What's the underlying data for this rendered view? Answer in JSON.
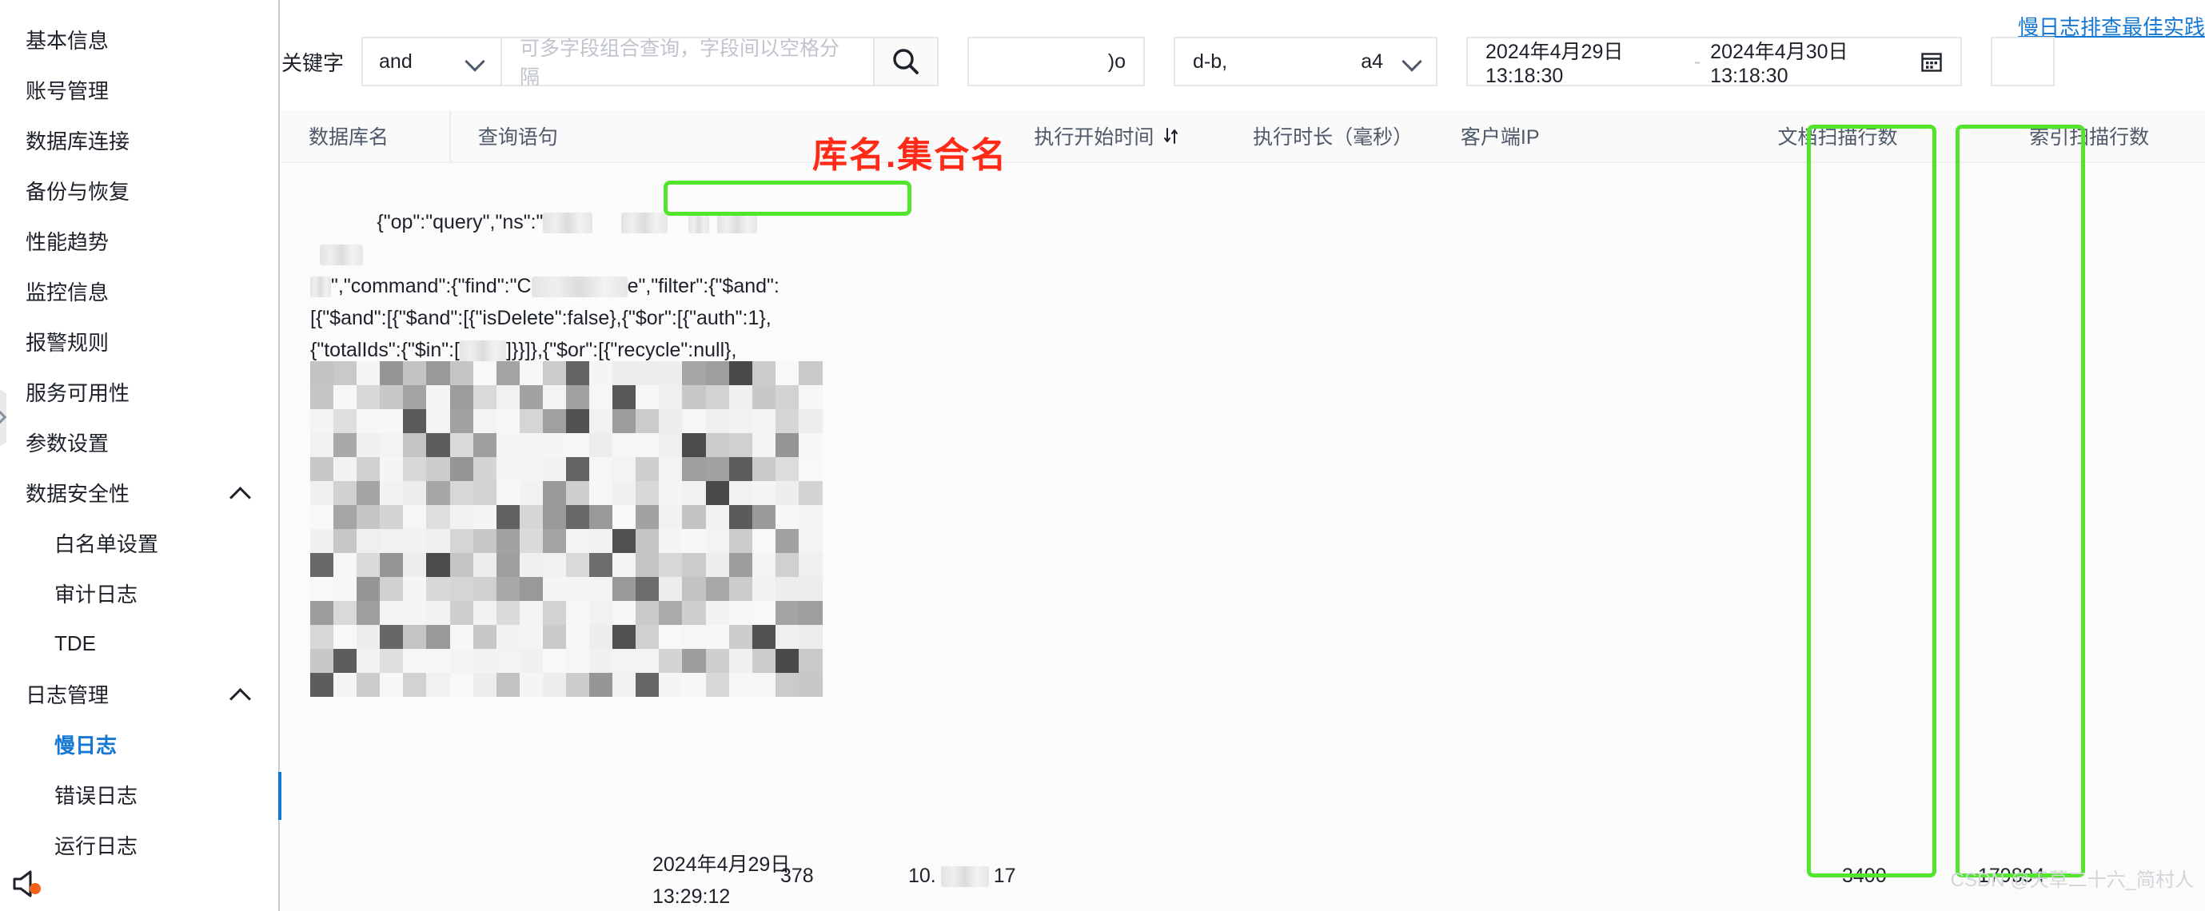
{
  "sidebar": {
    "items": [
      {
        "label": "基本信息",
        "level": 0,
        "expandable": false,
        "active": false
      },
      {
        "label": "账号管理",
        "level": 0,
        "expandable": false,
        "active": false
      },
      {
        "label": "数据库连接",
        "level": 0,
        "expandable": false,
        "active": false
      },
      {
        "label": "备份与恢复",
        "level": 0,
        "expandable": false,
        "active": false
      },
      {
        "label": "性能趋势",
        "level": 0,
        "expandable": false,
        "active": false
      },
      {
        "label": "监控信息",
        "level": 0,
        "expandable": false,
        "active": false
      },
      {
        "label": "报警规则",
        "level": 0,
        "expandable": false,
        "active": false
      },
      {
        "label": "服务可用性",
        "level": 0,
        "expandable": false,
        "active": false
      },
      {
        "label": "参数设置",
        "level": 0,
        "expandable": false,
        "active": false
      },
      {
        "label": "数据安全性",
        "level": 0,
        "expandable": true,
        "active": false
      },
      {
        "label": "白名单设置",
        "level": 1,
        "expandable": false,
        "active": false
      },
      {
        "label": "审计日志",
        "level": 1,
        "expandable": false,
        "active": false
      },
      {
        "label": "TDE",
        "level": 1,
        "expandable": false,
        "active": false
      },
      {
        "label": "日志管理",
        "level": 0,
        "expandable": true,
        "active": false
      },
      {
        "label": "慢日志",
        "level": 1,
        "expandable": false,
        "active": true
      },
      {
        "label": "错误日志",
        "level": 1,
        "expandable": false,
        "active": false
      },
      {
        "label": "运行日志",
        "level": 1,
        "expandable": false,
        "active": false
      }
    ],
    "collapse_handle": "collapse-sidebar",
    "announcement_icon": "speaker-icon"
  },
  "header": {
    "best_practice_link": "慢日志排查最佳实践"
  },
  "toolbar": {
    "keyword_label": "关键字",
    "logic_operator": "and",
    "keyword_placeholder": "可多字段组合查询，字段间以空格分隔",
    "keyword_value": "",
    "search_icon": "search-icon",
    "node_filter_value": ")o",
    "instance_value_left": "d-b,",
    "instance_value_mid": "⸮",
    "instance_value_right": "a4",
    "date_start": "2024年4月29日 13:18:30",
    "date_separator": "-",
    "date_end": "2024年4月30日 13:18:30",
    "calendar_icon": "calendar-icon"
  },
  "table": {
    "columns": [
      {
        "key": "db",
        "label": "数据库名"
      },
      {
        "key": "q",
        "label": "查询语句"
      },
      {
        "key": "st",
        "label": "执行开始时间",
        "sortable": true
      },
      {
        "key": "dur",
        "label": "执行时长（毫秒）"
      },
      {
        "key": "ip",
        "label": "客户端IP"
      },
      {
        "key": "docs",
        "label": "文档扫描行数"
      },
      {
        "key": "idx",
        "label": "索引扫描行数"
      }
    ],
    "rows": [
      {
        "db": "",
        "query": "{\"op\":\"query\",\"ns\":\"▒▒▒▒ .▒▒ ▒▒▒▒ ▒▒▒▒ .▒▒▒▒▒▒\",\"command\":{\"find\":\"C▒▒▒▒▒▒e\",\"filter\":{\"$and\":[{\"$and\":[{\"$and\":[{\"isDelete\":false},{\"$or\":[{\"auth\":1},{\"totalIds\":{\"$in\":[▒▒▒▒]}}]},{\"$or\":[{\"recycle\":null},{\"recycle\":0}]}],\"classroomName\":{\"$regex\":\".*大口加小口.*\",\"$options\":\"\"}},{\"createdOn\":{\"$gte\":{\"$date\":\"2023-04-29T00:00:00.000+0800\"}}}]},{\"createdOn\":{\"$lte\":{\"$date\":\"2024-04-30T00:00:00.000+0800\"}}}]},\"projection\":{\"$sortKey\":{\"$meta\":\"sortKey\"}},\"sort\":{\"createdOn\":-1},\"limit\":{\"$numberLong\":\"20\"},\"s",
        "start_time_line1": "2024年4月29日",
        "start_time_line2": "13:29:12",
        "duration": "378",
        "client_ip_prefix": "10.",
        "client_ip_suffix": "17",
        "docs_scanned": "3400",
        "index_scanned": "179894"
      }
    ]
  },
  "annotations": {
    "red_note": "库名.集合名",
    "highlight_color": "#52e52b",
    "red_color": "#ff2a17",
    "accent_color": "#1677d2"
  },
  "watermark": "CSDN @天草二十六_简村人"
}
